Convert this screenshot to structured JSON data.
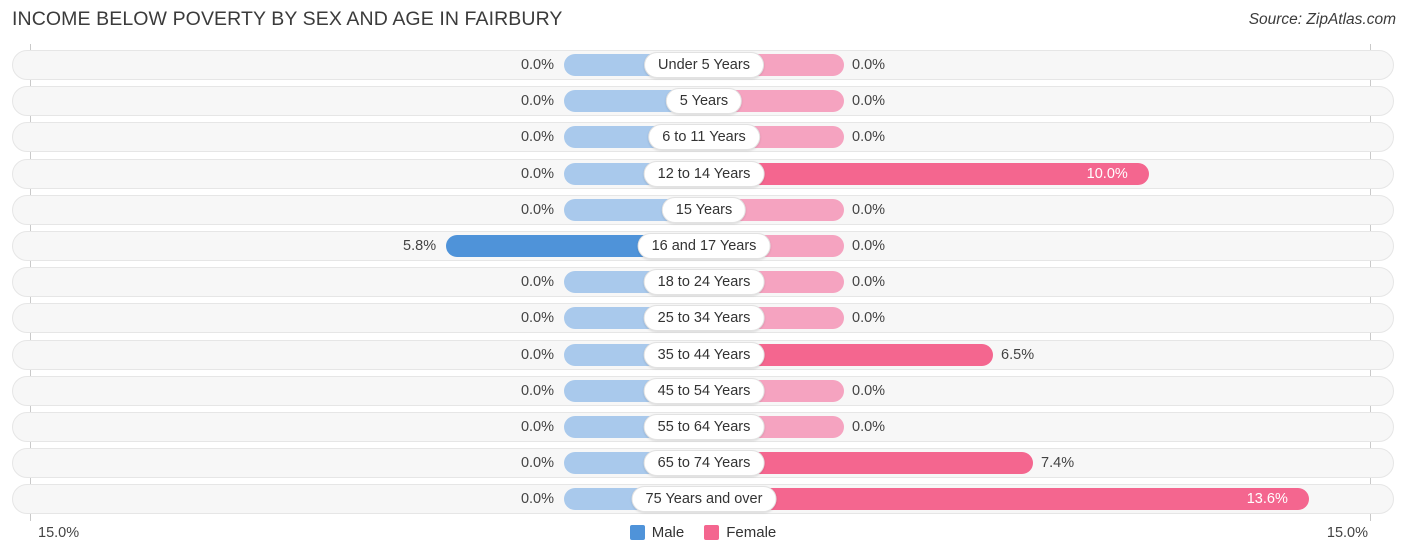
{
  "header": {
    "title": "INCOME BELOW POVERTY BY SEX AND AGE IN FAIRBURY",
    "source": "Source: ZipAtlas.com"
  },
  "legend": {
    "male": {
      "label": "Male",
      "color": "#4f93d9"
    },
    "female": {
      "label": "Female",
      "color": "#f4668f"
    }
  },
  "axis": {
    "left_tick": "15.0%",
    "right_tick": "15.0%"
  },
  "chart_data": {
    "type": "bar",
    "orientation": "horizontal-diverging",
    "title": "INCOME BELOW POVERTY BY SEX AND AGE IN FAIRBURY",
    "xlabel": "",
    "ylabel": "",
    "xlim": [
      -15.0,
      15.0
    ],
    "axis_max_percent": 15.0,
    "grid": false,
    "legend_position": "bottom-center",
    "categories": [
      "Under 5 Years",
      "5 Years",
      "6 to 11 Years",
      "12 to 14 Years",
      "15 Years",
      "16 and 17 Years",
      "18 to 24 Years",
      "25 to 34 Years",
      "35 to 44 Years",
      "45 to 54 Years",
      "55 to 64 Years",
      "65 to 74 Years",
      "75 Years and over"
    ],
    "series": [
      {
        "name": "Male",
        "values": [
          0.0,
          0.0,
          0.0,
          0.0,
          0.0,
          5.8,
          0.0,
          0.0,
          0.0,
          0.0,
          0.0,
          0.0,
          0.0
        ],
        "labels": [
          "0.0%",
          "0.0%",
          "0.0%",
          "0.0%",
          "0.0%",
          "5.8%",
          "0.0%",
          "0.0%",
          "0.0%",
          "0.0%",
          "0.0%",
          "0.0%",
          "0.0%"
        ]
      },
      {
        "name": "Female",
        "values": [
          0.0,
          0.0,
          0.0,
          10.0,
          0.0,
          0.0,
          0.0,
          0.0,
          6.5,
          0.0,
          0.0,
          7.4,
          13.6
        ],
        "labels": [
          "0.0%",
          "0.0%",
          "0.0%",
          "10.0%",
          "0.0%",
          "0.0%",
          "0.0%",
          "0.0%",
          "6.5%",
          "0.0%",
          "0.0%",
          "7.4%",
          "13.6%"
        ]
      }
    ]
  }
}
